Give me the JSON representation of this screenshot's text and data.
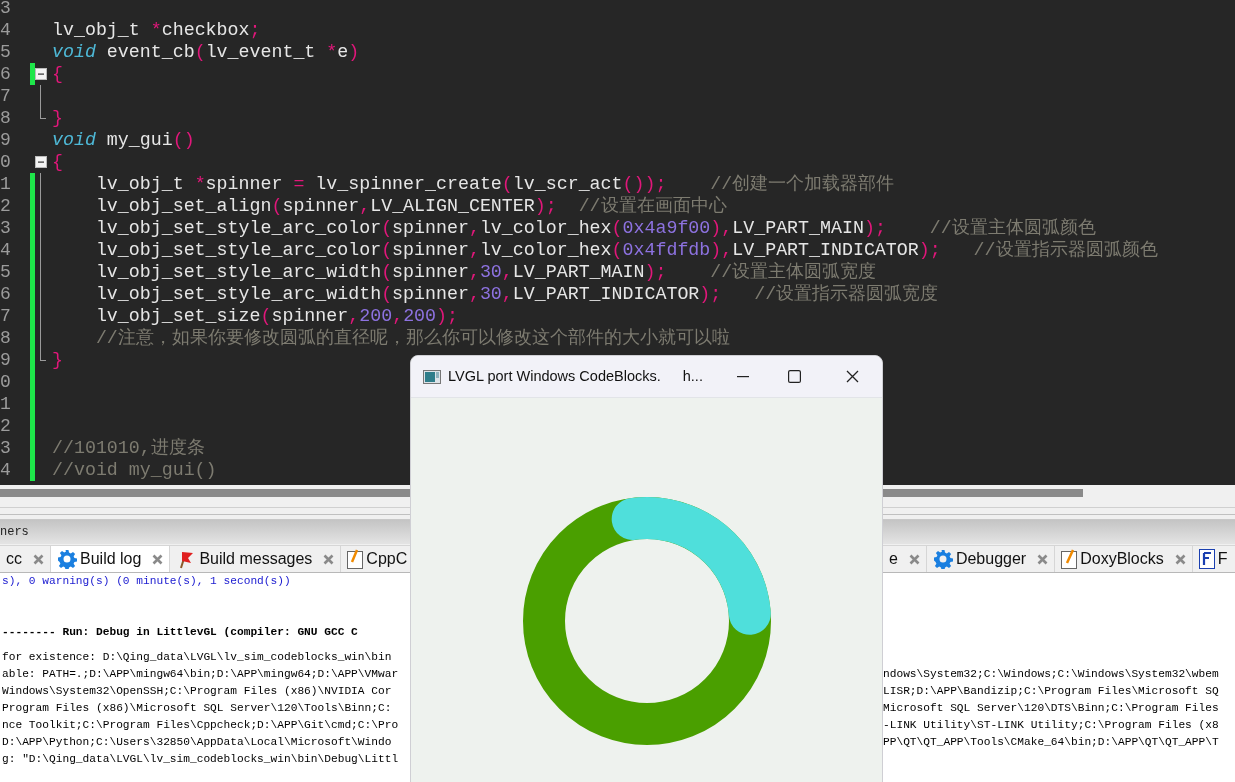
{
  "editor": {
    "lines": [
      {
        "number": "3",
        "changed": false,
        "fold_start": false,
        "in_fold": false,
        "fold_end": false
      },
      {
        "number": "4",
        "changed": false,
        "fold_start": false,
        "in_fold": false,
        "fold_end": false,
        "tokens": [
          {
            "kind": "plain",
            "text": "lv_obj_t "
          },
          {
            "kind": "op",
            "text": "*"
          },
          {
            "kind": "plain",
            "text": "checkbox"
          },
          {
            "kind": "op",
            "text": ";"
          }
        ]
      },
      {
        "number": "5",
        "changed": false,
        "fold_start": false,
        "in_fold": false,
        "fold_end": false,
        "tokens": [
          {
            "kind": "keyword",
            "text": "void"
          },
          {
            "kind": "plain",
            "text": " event_cb"
          },
          {
            "kind": "op",
            "text": "("
          },
          {
            "kind": "plain",
            "text": "lv_event_t "
          },
          {
            "kind": "op",
            "text": "*"
          },
          {
            "kind": "plain",
            "text": "e"
          },
          {
            "kind": "op",
            "text": ")"
          }
        ]
      },
      {
        "number": "6",
        "changed": true,
        "fold_start": true,
        "in_fold": false,
        "fold_end": false,
        "tokens": [
          {
            "kind": "op",
            "text": "{"
          }
        ]
      },
      {
        "number": "7",
        "changed": false,
        "fold_start": false,
        "in_fold": true,
        "fold_end": false
      },
      {
        "number": "8",
        "changed": false,
        "fold_start": false,
        "in_fold": false,
        "fold_end": true,
        "tokens": [
          {
            "kind": "op",
            "text": "}"
          }
        ]
      },
      {
        "number": "9",
        "changed": false,
        "fold_start": false,
        "in_fold": false,
        "fold_end": false,
        "tokens": [
          {
            "kind": "keyword",
            "text": "void"
          },
          {
            "kind": "plain",
            "text": " my_gui"
          },
          {
            "kind": "op",
            "text": "()"
          }
        ]
      },
      {
        "number": "0",
        "changed": false,
        "fold_start": true,
        "in_fold": false,
        "fold_end": false,
        "tokens": [
          {
            "kind": "op",
            "text": "{"
          }
        ]
      },
      {
        "number": "1",
        "changed": true,
        "fold_start": false,
        "in_fold": true,
        "fold_end": false,
        "tokens": [
          {
            "kind": "plain",
            "text": "    lv_obj_t "
          },
          {
            "kind": "op",
            "text": "*"
          },
          {
            "kind": "plain",
            "text": "spinner "
          },
          {
            "kind": "op",
            "text": "="
          },
          {
            "kind": "plain",
            "text": " lv_spinner_create"
          },
          {
            "kind": "op",
            "text": "("
          },
          {
            "kind": "plain",
            "text": "lv_scr_act"
          },
          {
            "kind": "op",
            "text": "())"
          },
          {
            "kind": "op",
            "text": ";    "
          },
          {
            "kind": "comment",
            "text": "//创建一个加载器部件"
          }
        ]
      },
      {
        "number": "2",
        "changed": true,
        "fold_start": false,
        "in_fold": true,
        "fold_end": false,
        "tokens": [
          {
            "kind": "plain",
            "text": "    lv_obj_set_align"
          },
          {
            "kind": "op",
            "text": "("
          },
          {
            "kind": "plain",
            "text": "spinner"
          },
          {
            "kind": "op",
            "text": ","
          },
          {
            "kind": "plain",
            "text": "LV_ALIGN_CENTER"
          },
          {
            "kind": "op",
            "text": ");  "
          },
          {
            "kind": "comment",
            "text": "//设置在画面中心"
          }
        ]
      },
      {
        "number": "3",
        "changed": true,
        "fold_start": false,
        "in_fold": true,
        "fold_end": false,
        "tokens": [
          {
            "kind": "plain",
            "text": "    lv_obj_set_style_arc_color"
          },
          {
            "kind": "op",
            "text": "("
          },
          {
            "kind": "plain",
            "text": "spinner"
          },
          {
            "kind": "op",
            "text": ","
          },
          {
            "kind": "plain",
            "text": "lv_color_hex"
          },
          {
            "kind": "op",
            "text": "("
          },
          {
            "kind": "number",
            "text": "0x4a9f00"
          },
          {
            "kind": "op",
            "text": "),"
          },
          {
            "kind": "plain",
            "text": "LV_PART_MAIN"
          },
          {
            "kind": "op",
            "text": ");    "
          },
          {
            "kind": "comment",
            "text": "//设置主体圆弧颜色"
          }
        ]
      },
      {
        "number": "4",
        "changed": true,
        "fold_start": false,
        "in_fold": true,
        "fold_end": false,
        "tokens": [
          {
            "kind": "plain",
            "text": "    lv_obj_set_style_arc_color"
          },
          {
            "kind": "op",
            "text": "("
          },
          {
            "kind": "plain",
            "text": "spinner"
          },
          {
            "kind": "op",
            "text": ","
          },
          {
            "kind": "plain",
            "text": "lv_color_hex"
          },
          {
            "kind": "op",
            "text": "("
          },
          {
            "kind": "number",
            "text": "0x4fdfdb"
          },
          {
            "kind": "op",
            "text": "),"
          },
          {
            "kind": "plain",
            "text": "LV_PART_INDICATOR"
          },
          {
            "kind": "op",
            "text": ");   "
          },
          {
            "kind": "comment",
            "text": "//设置指示器圆弧颜色"
          }
        ]
      },
      {
        "number": "5",
        "changed": true,
        "fold_start": false,
        "in_fold": true,
        "fold_end": false,
        "tokens": [
          {
            "kind": "plain",
            "text": "    lv_obj_set_style_arc_width"
          },
          {
            "kind": "op",
            "text": "("
          },
          {
            "kind": "plain",
            "text": "spinner"
          },
          {
            "kind": "op",
            "text": ","
          },
          {
            "kind": "number",
            "text": "30"
          },
          {
            "kind": "op",
            "text": ","
          },
          {
            "kind": "plain",
            "text": "LV_PART_MAIN"
          },
          {
            "kind": "op",
            "text": ");    "
          },
          {
            "kind": "comment",
            "text": "//设置主体圆弧宽度"
          }
        ]
      },
      {
        "number": "6",
        "changed": true,
        "fold_start": false,
        "in_fold": true,
        "fold_end": false,
        "tokens": [
          {
            "kind": "plain",
            "text": "    lv_obj_set_style_arc_width"
          },
          {
            "kind": "op",
            "text": "("
          },
          {
            "kind": "plain",
            "text": "spinner"
          },
          {
            "kind": "op",
            "text": ","
          },
          {
            "kind": "number",
            "text": "30"
          },
          {
            "kind": "op",
            "text": ","
          },
          {
            "kind": "plain",
            "text": "LV_PART_INDICATOR"
          },
          {
            "kind": "op",
            "text": ");   "
          },
          {
            "kind": "comment",
            "text": "//设置指示器圆弧宽度"
          }
        ]
      },
      {
        "number": "7",
        "changed": true,
        "fold_start": false,
        "in_fold": true,
        "fold_end": false,
        "tokens": [
          {
            "kind": "plain",
            "text": "    lv_obj_set_size"
          },
          {
            "kind": "op",
            "text": "("
          },
          {
            "kind": "plain",
            "text": "spinner"
          },
          {
            "kind": "op",
            "text": ","
          },
          {
            "kind": "number",
            "text": "200"
          },
          {
            "kind": "op",
            "text": ","
          },
          {
            "kind": "number",
            "text": "200"
          },
          {
            "kind": "op",
            "text": ");"
          }
        ]
      },
      {
        "number": "8",
        "changed": true,
        "fold_start": false,
        "in_fold": true,
        "fold_end": false,
        "tokens": [
          {
            "kind": "comment",
            "text": "    //注意，如果你要修改圆弧的直径呢，那么你可以修改这个部件的大小就可以啦"
          }
        ]
      },
      {
        "number": "9",
        "changed": true,
        "fold_start": false,
        "in_fold": false,
        "fold_end": true,
        "tokens": [
          {
            "kind": "op",
            "text": "}"
          }
        ]
      },
      {
        "number": "0",
        "changed": true,
        "fold_start": false,
        "in_fold": false,
        "fold_end": false
      },
      {
        "number": "1",
        "changed": true,
        "fold_start": false,
        "in_fold": false,
        "fold_end": false
      },
      {
        "number": "2",
        "changed": true,
        "fold_start": false,
        "in_fold": false,
        "fold_end": false
      },
      {
        "number": "3",
        "changed": true,
        "fold_start": false,
        "in_fold": false,
        "fold_end": false,
        "tokens": [
          {
            "kind": "comment",
            "text": "//101010,进度条"
          }
        ]
      },
      {
        "number": "4",
        "changed": true,
        "fold_start": false,
        "in_fold": false,
        "fold_end": false,
        "tokens": [
          {
            "kind": "comment",
            "text": "//void my_gui()"
          }
        ]
      }
    ]
  },
  "panel": {
    "title": "ners",
    "tabs_left": [
      {
        "label": "cc",
        "kind": "plain",
        "closable": true,
        "selected": false
      },
      {
        "label": "Build log",
        "kind": "gear",
        "closable": true,
        "selected": true
      },
      {
        "label": "Build messages",
        "kind": "flag",
        "closable": true,
        "selected": false
      },
      {
        "label": "CppC",
        "kind": "notepad",
        "closable": false,
        "selected": false
      }
    ],
    "tabs_right": [
      {
        "label": "e",
        "kind": "plain",
        "closable": true,
        "selected": false
      },
      {
        "label": "Debugger",
        "kind": "gear",
        "closable": true,
        "selected": false
      },
      {
        "label": "DoxyBlocks",
        "kind": "pencil",
        "closable": true,
        "selected": false
      },
      {
        "label": "F",
        "kind": "file",
        "closable": false,
        "selected": false
      }
    ],
    "log": [
      {
        "kind": "summary",
        "left": "s), 0 warning(s) (0 minute(s), 1 second(s))"
      },
      {
        "kind": "heading",
        "left": "-------- Run: Debug in LittlevGL (compiler: GNU GCC C"
      },
      {
        "kind": "plain",
        "left": "for existence: D:\\Qing_data\\LVGL\\lv_sim_codeblocks_win\\bin"
      },
      {
        "kind": "plain",
        "left": "able: PATH=.;D:\\APP\\mingw64\\bin;D:\\APP\\mingw64;D:\\APP\\VMwar",
        "right": "ndows\\System32;C:\\Windows;C:\\Windows\\System32\\wbem"
      },
      {
        "kind": "plain",
        "left": "Windows\\System32\\OpenSSH;C:\\Program Files (x86)\\NVIDIA Cor",
        "right": "LISR;D:\\APP\\Bandizip;C:\\Program Files\\Microsoft SQ"
      },
      {
        "kind": "plain",
        "left": "Program Files (x86)\\Microsoft SQL Server\\120\\Tools\\Binn;C:",
        "right": "Microsoft SQL Server\\120\\DTS\\Binn;C:\\Program Files"
      },
      {
        "kind": "plain",
        "left": "nce Toolkit;C:\\Program Files\\Cppcheck;D:\\APP\\Git\\cmd;C:\\Pro",
        "right": "-LINK Utility\\ST-LINK Utility;C:\\Program Files (x8"
      },
      {
        "kind": "plain",
        "left": "D:\\APP\\Python;C:\\Users\\32850\\AppData\\Local\\Microsoft\\Windo",
        "right": "PP\\QT\\QT_APP\\Tools\\CMake_64\\bin;D:\\APP\\QT\\QT_APP\\T"
      },
      {
        "kind": "plain",
        "left": "g: \"D:\\Qing_data\\LVGL\\lv_sim_codeblocks_win\\bin\\Debug\\Littl"
      }
    ]
  },
  "window": {
    "title": "LVGL port Windows CodeBlocks.",
    "title_tail": "h..."
  }
}
